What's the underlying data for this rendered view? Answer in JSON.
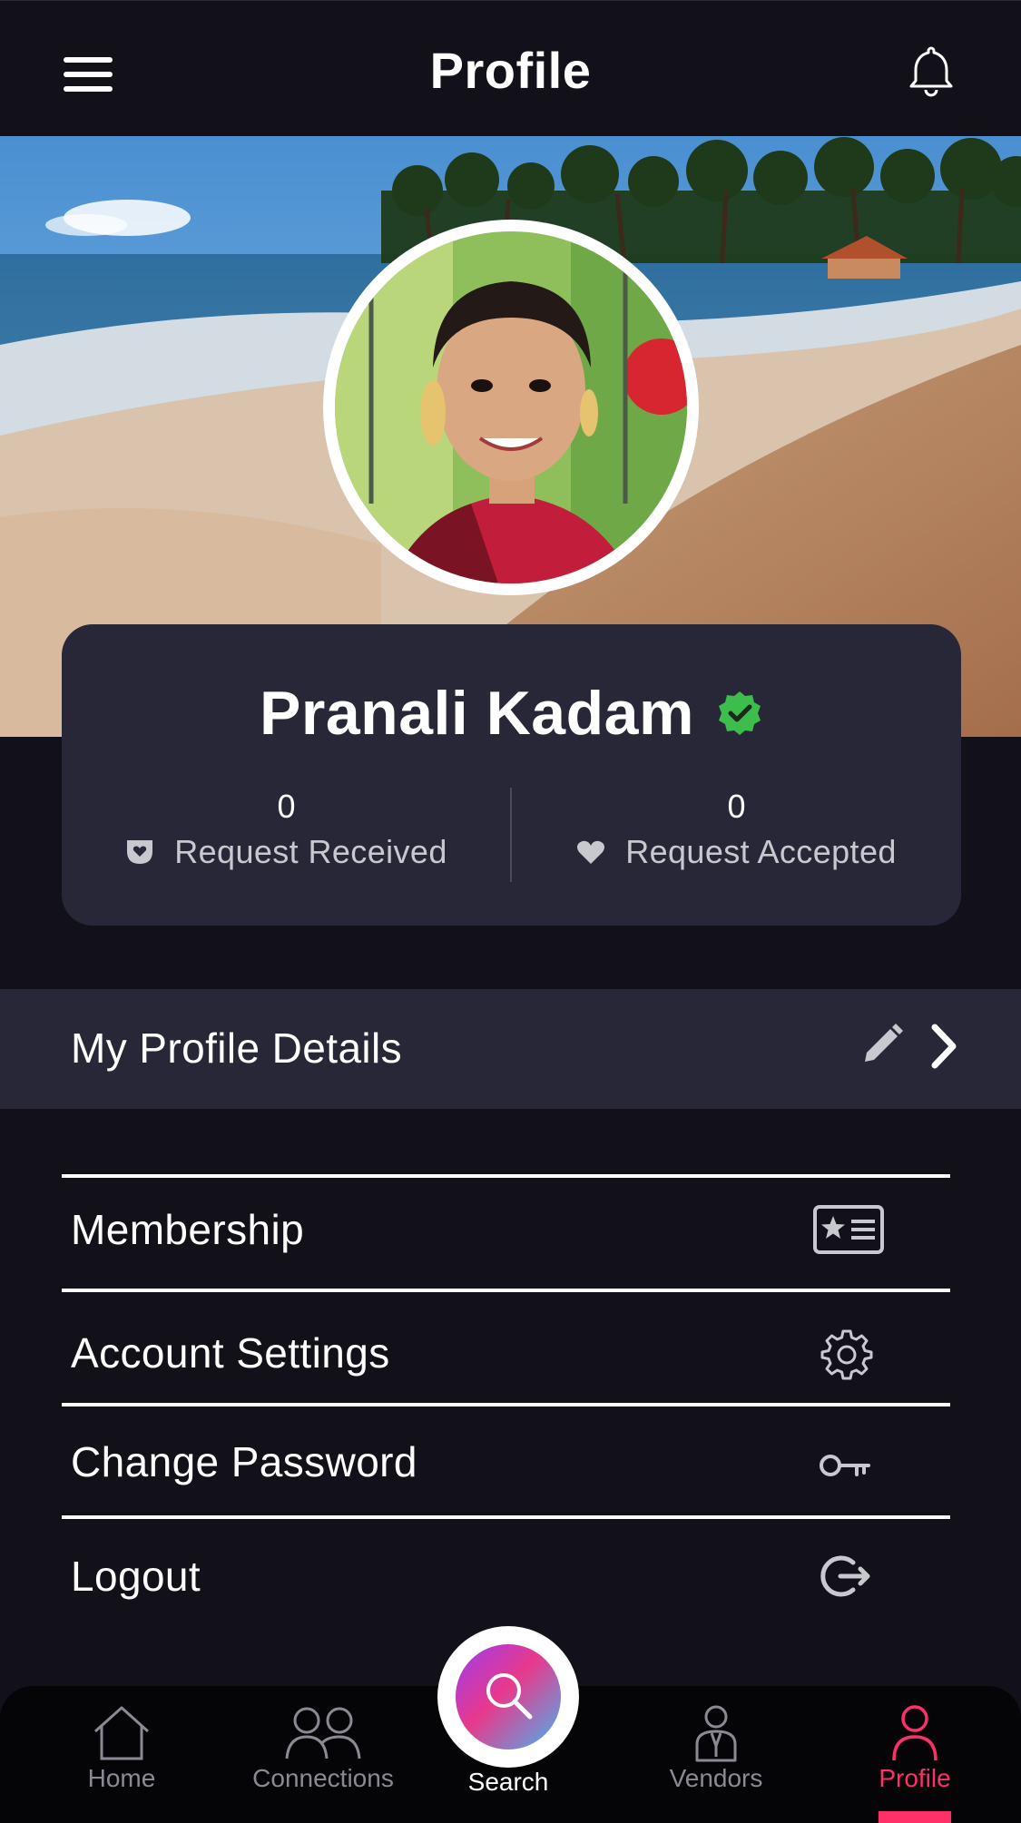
{
  "header": {
    "title": "Profile"
  },
  "profile": {
    "name": "Pranali Kadam",
    "verified": true,
    "stats": {
      "received_count": "0",
      "received_label": "Request Received",
      "accepted_count": "0",
      "accepted_label": "Request Accepted"
    }
  },
  "details": {
    "label": "My Profile Details"
  },
  "menu": {
    "items": [
      {
        "label": "Membership",
        "icon": "membership-card-icon"
      },
      {
        "label": "Account Settings",
        "icon": "gear-icon"
      },
      {
        "label": "Change Password",
        "icon": "key-icon"
      },
      {
        "label": "Logout",
        "icon": "logout-icon"
      }
    ]
  },
  "bottom_nav": {
    "items": [
      {
        "label": "Home",
        "icon": "home-icon"
      },
      {
        "label": "Connections",
        "icon": "people-icon"
      },
      {
        "label": "Search",
        "icon": "search-icon"
      },
      {
        "label": "Vendors",
        "icon": "vendor-icon"
      },
      {
        "label": "Profile",
        "icon": "person-icon",
        "active": true
      }
    ]
  },
  "colors": {
    "background": "#121119",
    "card": "#272737",
    "accent": "#ff2f67",
    "verified": "#3dbd4b",
    "muted_text": "#c8c8cf"
  }
}
